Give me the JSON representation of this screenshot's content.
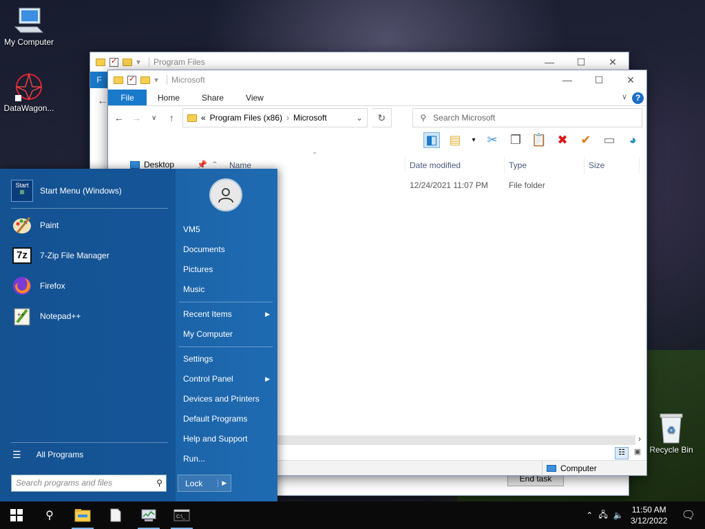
{
  "desktop_icons": [
    {
      "label": "My Computer",
      "icon": "computer-icon"
    },
    {
      "label": "DataWagon...",
      "icon": "datawagon-icon"
    },
    {
      "label": "Recycle Bin",
      "icon": "recycle-bin-icon"
    }
  ],
  "back_window": {
    "title": "Program Files",
    "ribbon_file": "F"
  },
  "front_window": {
    "title": "Microsoft",
    "tabs": [
      "File",
      "Home",
      "Share",
      "View"
    ],
    "address": {
      "prefix": "«",
      "parts": [
        "Program Files (x86)",
        "Microsoft"
      ]
    },
    "search_placeholder": "Search Microsoft",
    "nav_item": "Desktop",
    "columns": [
      "Name",
      "Date modified",
      "Type",
      "Size"
    ],
    "rows": [
      {
        "name": "",
        "date": "12/24/2021 11:07 PM",
        "type": "File folder",
        "size": ""
      }
    ],
    "status_location": "Computer"
  },
  "end_task_label": "End task",
  "start_menu": {
    "pinned": {
      "label": "Start Menu (Windows)",
      "badge": "Start"
    },
    "programs": [
      {
        "label": "Paint",
        "icon": "paint-icon"
      },
      {
        "label": "7-Zip File Manager",
        "icon": "7zip-icon",
        "glyph": "7z"
      },
      {
        "label": "Firefox",
        "icon": "firefox-icon"
      },
      {
        "label": "Notepad++",
        "icon": "notepad-plus-plus-icon"
      }
    ],
    "all_programs": "All Programs",
    "search_placeholder": "Search programs and files",
    "right_items": [
      {
        "label": "VM5",
        "arrow": false
      },
      {
        "label": "Documents",
        "arrow": false
      },
      {
        "label": "Pictures",
        "arrow": false
      },
      {
        "label": "Music",
        "arrow": false
      },
      {
        "label": "Recent Items",
        "arrow": true
      },
      {
        "label": "My Computer",
        "arrow": false
      },
      {
        "label": "Settings",
        "arrow": false
      },
      {
        "label": "Control Panel",
        "arrow": true
      },
      {
        "label": "Devices and Printers",
        "arrow": false
      },
      {
        "label": "Default Programs",
        "arrow": false
      },
      {
        "label": "Help and Support",
        "arrow": false
      },
      {
        "label": "Run...",
        "arrow": false
      }
    ],
    "lock_label": "Lock"
  },
  "taskbar": {
    "time": "11:50 AM",
    "date": "3/12/2022"
  },
  "colors": {
    "start_menu": "#1c63a8",
    "ribbon_file": "#1979ca",
    "taskbar": "#0a0a0a"
  }
}
